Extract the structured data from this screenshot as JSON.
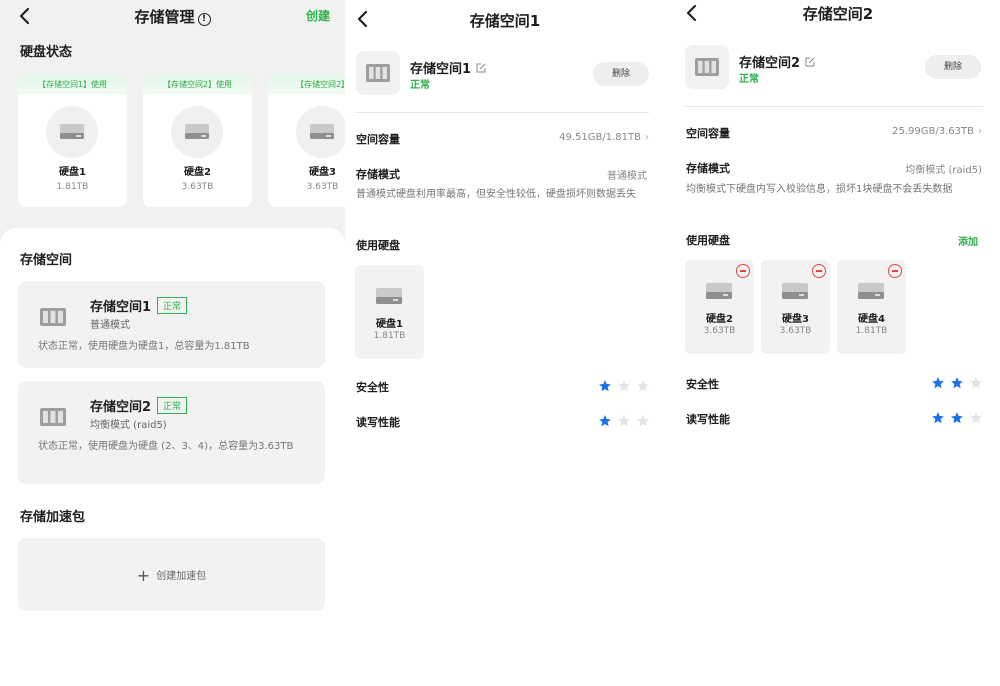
{
  "panel1": {
    "title": "存储管理",
    "info_symbol": "!",
    "create_label": "创建",
    "disk_status_title": "硬盘状态",
    "disks": [
      {
        "tag": "【存储空间1】使用",
        "name": "硬盘1",
        "size": "1.81TB"
      },
      {
        "tag": "【存储空间2】使用",
        "name": "硬盘2",
        "size": "3.63TB"
      },
      {
        "tag": "【存储空间2】",
        "name": "硬盘3",
        "size": "3.63TB"
      }
    ],
    "spaces_title": "存储空间",
    "spaces": [
      {
        "name": "存储空间1",
        "badge": "正常",
        "mode": "普通模式",
        "desc": "状态正常，使用硬盘为硬盘1，总容量为1.81TB"
      },
      {
        "name": "存储空间2",
        "badge": "正常",
        "mode": "均衡模式 (raid5)",
        "desc": "状态正常，使用硬盘为硬盘 (2、3、4)，总容量为3.63TB"
      }
    ],
    "accel_title": "存储加速包",
    "accel_create_label": "创建加速包"
  },
  "panel2": {
    "title": "存储空间1",
    "name": "存储空间1",
    "status": "正常",
    "delete_label": "删除",
    "capacity_label": "空间容量",
    "capacity_value": "49.51GB/1.81TB",
    "mode_label": "存储模式",
    "mode_value": "普通模式",
    "mode_desc": "普通模式硬盘利用率最高，但安全性较低，硬盘损坏则数据丢失",
    "used_disks_label": "使用硬盘",
    "used_disks": [
      {
        "name": "硬盘1",
        "size": "1.81TB"
      }
    ],
    "security_label": "安全性",
    "security_rating": 1,
    "perf_label": "读写性能",
    "perf_rating": 1
  },
  "panel3": {
    "title": "存储空间2",
    "name": "存储空间2",
    "status": "正常",
    "delete_label": "删除",
    "capacity_label": "空间容量",
    "capacity_value": "25.99GB/3.63TB",
    "mode_label": "存储模式",
    "mode_value": "均衡模式 (raid5)",
    "mode_desc": "均衡模式下硬盘内写入校验信息，损坏1块硬盘不会丢失数据",
    "used_disks_label": "使用硬盘",
    "add_label": "添加",
    "used_disks": [
      {
        "name": "硬盘2",
        "size": "3.63TB"
      },
      {
        "name": "硬盘3",
        "size": "3.63TB"
      },
      {
        "name": "硬盘4",
        "size": "1.81TB"
      }
    ],
    "security_label": "安全性",
    "security_rating": 2,
    "perf_label": "读写性能",
    "perf_rating": 2
  },
  "colors": {
    "accent_green": "#2fb24c",
    "star_on": "#1a73e8",
    "star_off": "#e3e3e3",
    "remove_red": "#e04646"
  },
  "icons": [
    "back-icon",
    "info-icon",
    "hdd-icon",
    "storage-array-icon",
    "edit-icon",
    "chevron-right-icon",
    "plus-icon",
    "remove-icon",
    "star-icon"
  ]
}
